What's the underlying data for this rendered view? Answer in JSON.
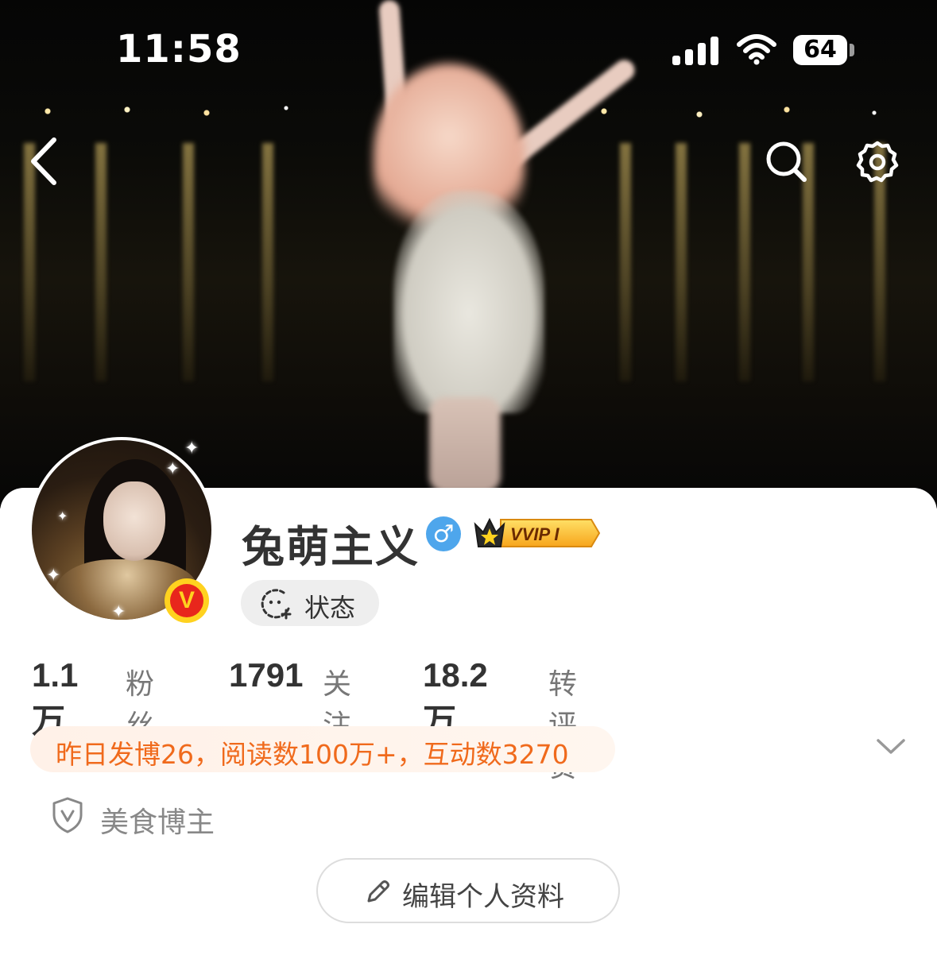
{
  "status_bar": {
    "time": "11:58",
    "battery": "64"
  },
  "profile": {
    "username": "兔萌主义",
    "gender_symbol": "♂",
    "vip_label": "VVIP I",
    "verified_mark": "V",
    "status_label": "状态"
  },
  "stats": [
    {
      "value": "1.1万",
      "label": "粉丝"
    },
    {
      "value": "1791",
      "label": "关注"
    },
    {
      "value": "18.2万",
      "label": "转评赞"
    }
  ],
  "activity_banner": "昨日发博26，阅读数100万+，互动数3270",
  "tag": "美食博主",
  "edit_button": "编辑个人资料",
  "colors": {
    "accent_orange": "#f06a1c",
    "gender_blue": "#4ea6ec",
    "badge_yellow": "#ffd21f",
    "badge_red": "#e8261c"
  }
}
